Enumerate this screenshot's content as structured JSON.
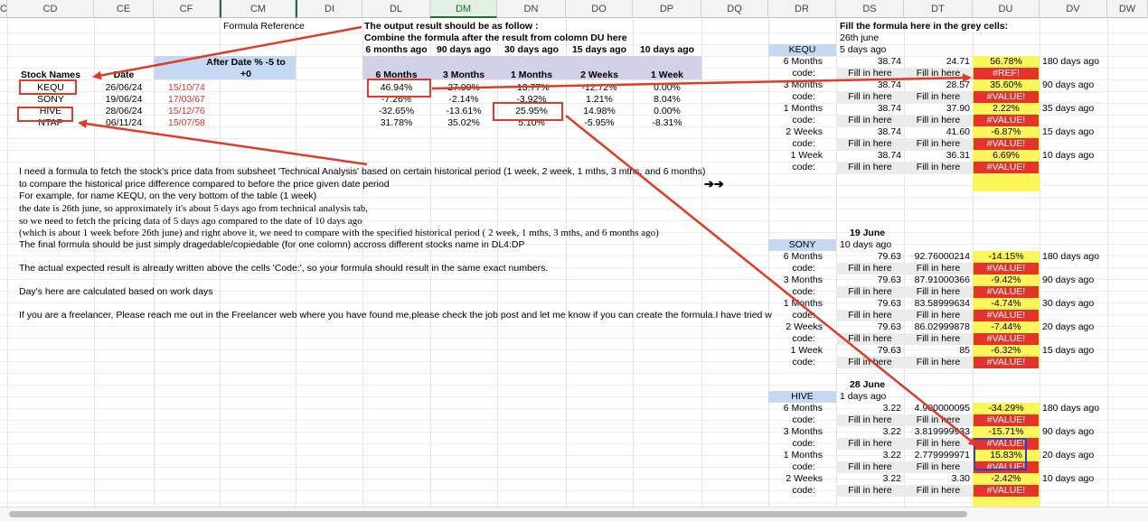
{
  "columns": [
    {
      "label": "C"
    },
    {
      "label": "CD"
    },
    {
      "label": "CE"
    },
    {
      "label": "CF"
    },
    {
      "label": "CM"
    },
    {
      "label": "DI"
    },
    {
      "label": "DL"
    },
    {
      "label": "DM"
    },
    {
      "label": "DN"
    },
    {
      "label": "DO"
    },
    {
      "label": "DP"
    },
    {
      "label": "DQ"
    },
    {
      "label": "DR"
    },
    {
      "label": "DS"
    },
    {
      "label": "DT"
    },
    {
      "label": "DU"
    },
    {
      "label": "DV"
    },
    {
      "label": "DW"
    }
  ],
  "left": {
    "formula_reference": "Formula Reference",
    "after_date_header": "After Date % -5 to +0",
    "stock_names_header": "Stock Names",
    "date_header": "Date",
    "stocks": [
      {
        "name": "KEQU",
        "date": "26/06/24",
        "after": "15/10/74"
      },
      {
        "name": "SONY",
        "date": "19/06/24",
        "after": "17/03/67"
      },
      {
        "name": "HIVE",
        "date": "28/06/24",
        "after": "15/12/76"
      },
      {
        "name": "NTAP",
        "date": "06/11/24",
        "after": "15/07/58"
      }
    ]
  },
  "expected": {
    "title1": "The output result should be as follow :",
    "title2": "Combine the formula after the result from colomn DU here",
    "ago": [
      "6 months ago",
      "90 days ago",
      "30 days ago",
      "15 days ago",
      "10 days ago"
    ],
    "periods": [
      "6 Months",
      "3 Months",
      "1 Months",
      "2 Weeks",
      "1 Week"
    ],
    "rows": [
      [
        "46.94%",
        "27.09%",
        "-13.77%",
        "-12.72%",
        "0.00%"
      ],
      [
        "-7.26%",
        "-2.14%",
        "-3.92%",
        "1.21%",
        "8.04%"
      ],
      [
        "-32.65%",
        "-13.61%",
        "25.95%",
        "14.98%",
        "0.00%"
      ],
      [
        "31.78%",
        "35.02%",
        "5.10%",
        "-5.95%",
        "-8.31%"
      ]
    ]
  },
  "notes": [
    "I need a formula to fetch the stock's price data from subsheet 'Technical Analysis' based on certain historical period (1 week, 2 week, 1 mths, 3 mths, and 6 months)",
    "to compare the historical price difference compared to before the price given date period",
    "For example, for name KEQU,  on the very bottom of the table (1 week)",
    "the date is 26th june, so approximately it's about 5 days ago from technical analysis tab,",
    "so we need to fetch the pricing data of 5 days ago compared to the date of 10 days ago",
    "(which is about 1 week before 26th june) and right above it, we need to compare with the specified historical period ( 2 week, 1 mths, 3 mths, and 6 months ago)",
    "The final formula should be just simply dragedable/copiedable (for one colomn) accross different stocks name in DL4:DP",
    "The actual expected result is already written above the cells 'Code:', so your formula should result in the same exact numbers.",
    "Day's here are calculated based on work days",
    "If you are a freelancer, Please reach me out in the Freelancer web where you have found me,please check the job post and let me know if you can create the formula.I have tried w"
  ],
  "arrows_glyph": "➔➔",
  "right": {
    "fill_title": "Fill the formula here in the grey cells:",
    "code_label": "code:",
    "fill_in": "Fill in here",
    "blocks": [
      {
        "date_heading": "26th june",
        "ticker": "KEQU",
        "ticker_ago": "5 days ago",
        "rows": [
          {
            "period": "6 Months",
            "ds": "38.74",
            "dt": "24.71",
            "pct": "56.78%",
            "ago": "180 days ago",
            "err": "#REF!"
          },
          {
            "period": "3 Months",
            "ds": "38.74",
            "dt": "28.57",
            "pct": "35.60%",
            "ago": "90 days ago",
            "err": "#VALUE!"
          },
          {
            "period": "1 Months",
            "ds": "38.74",
            "dt": "37.90",
            "pct": "2.22%",
            "ago": "35 days ago",
            "err": "#VALUE!"
          },
          {
            "period": "2 Weeks",
            "ds": "38.74",
            "dt": "41.60",
            "pct": "-6.87%",
            "ago": "15 days ago",
            "err": "#VALUE!"
          },
          {
            "period": "1 Week",
            "ds": "38.74",
            "dt": "36.31",
            "pct": "6.69%",
            "ago": "10 days ago",
            "err": "#VALUE!"
          }
        ]
      },
      {
        "date_heading": "19 June",
        "ticker": "SONY",
        "ticker_ago": "10 days ago",
        "rows": [
          {
            "period": "6 Months",
            "ds": "79.63",
            "dt": "92.76000214",
            "pct": "-14.15%",
            "ago": "180 days ago",
            "err": "#VALUE!"
          },
          {
            "period": "3 Months",
            "ds": "79.63",
            "dt": "87.91000366",
            "pct": "-9.42%",
            "ago": "90 days ago",
            "err": "#VALUE!"
          },
          {
            "period": "1 Months",
            "ds": "79.63",
            "dt": "83.58999634",
            "pct": "-4.74%",
            "ago": "30 days ago",
            "err": "#VALUE!"
          },
          {
            "period": "2 Weeks",
            "ds": "79.63",
            "dt": "86.02999878",
            "pct": "-7.44%",
            "ago": "20 days ago",
            "err": "#VALUE!"
          },
          {
            "period": "1 Week",
            "ds": "79.63",
            "dt": "85",
            "pct": "-6.32%",
            "ago": "15 days ago",
            "err": "#VALUE!"
          }
        ]
      },
      {
        "date_heading": "28 June",
        "ticker": "HIVE",
        "ticker_ago": "1 days ago",
        "rows": [
          {
            "period": "6 Months",
            "ds": "3.22",
            "dt": "4.900000095",
            "pct": "-34.29%",
            "ago": "180 days ago",
            "err": "#VALUE!"
          },
          {
            "period": "3 Months",
            "ds": "3.22",
            "dt": "3.819999933",
            "pct": "-15.71%",
            "ago": "90 days ago",
            "err": "#VALUE!"
          },
          {
            "period": "1 Months",
            "ds": "3.22",
            "dt": "2.779999971",
            "pct": "15.83%",
            "ago": "20 days ago",
            "err": "#VALUE!"
          },
          {
            "period": "2 Weeks",
            "ds": "3.22",
            "dt": "3.30",
            "pct": "-2.42%",
            "ago": "10 days ago",
            "err": "#VALUE!"
          }
        ]
      }
    ]
  },
  "colors": {
    "yellow": "#fdf65a",
    "lavender": "#d3d0ea",
    "blue_header": "#c5d8f2",
    "grey_fill": "#ebebeb",
    "error_red": "#e5322b",
    "annotation_red": "#e03a28"
  }
}
